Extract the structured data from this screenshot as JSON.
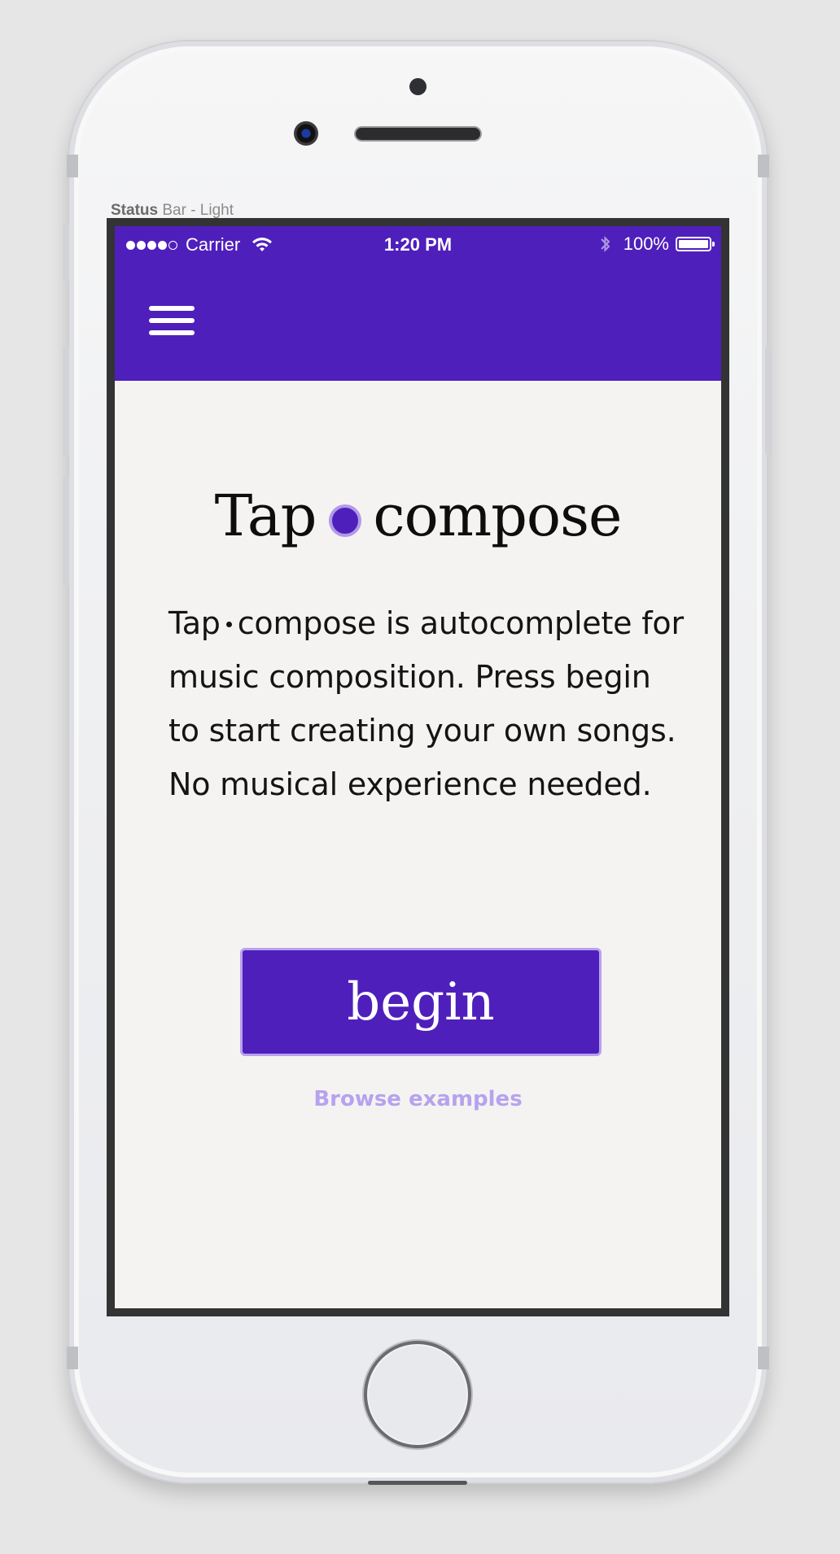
{
  "status_label": {
    "strong": "Status",
    "rest": " Bar - Light"
  },
  "status_bar": {
    "carrier": "Carrier",
    "time": "1:20 PM",
    "battery_pct": "100%",
    "signal_bars_filled": 4,
    "signal_bars_total": 5
  },
  "colors": {
    "brand_purple": "#4f1fbc",
    "accent_lavender": "#b7a2ee",
    "background": "#f4f3f2"
  },
  "header": {
    "menu_icon": "hamburger-menu-icon"
  },
  "main": {
    "title_left": "Tap",
    "title_right": "compose",
    "desc_left": "Tap",
    "desc_rest": "compose is autocomplete for music composition. Press begin to start creating your own songs. No musical experience needed.",
    "begin_label": "begin",
    "browse_label": "Browse examples"
  }
}
